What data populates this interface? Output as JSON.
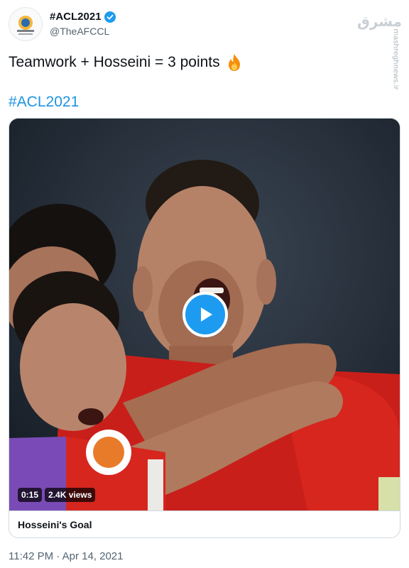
{
  "author": {
    "display_name": "#ACL2021",
    "handle": "@TheAFCCL",
    "verified": true,
    "avatar_icon": "afc-champions-league-logo"
  },
  "tweet": {
    "text": "Teamwork + Hosseini = 3 points",
    "emoji_icon": "fire-emoji",
    "hashtag": "#ACL2021"
  },
  "media": {
    "type": "video",
    "duration": "0:15",
    "views": "2.4K views",
    "caption": "Hosseini's Goal",
    "play_icon": "play-icon"
  },
  "timestamp": "11:42 PM · Apr 14, 2021",
  "watermark": {
    "logo_text": "مشرق",
    "site": "mashreghnews.ir"
  },
  "colors": {
    "accent": "#1d9bf0",
    "hashtag": "#1b95e0",
    "verified": "#1d9bf0",
    "jersey_red": "#d7261e",
    "jersey_purple": "#7a4bb6"
  }
}
